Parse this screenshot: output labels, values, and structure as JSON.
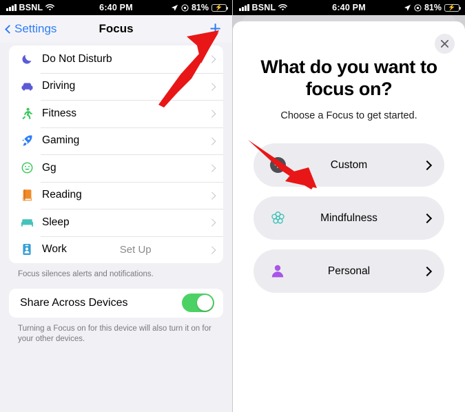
{
  "status_bar": {
    "carrier": "BSNL",
    "time": "6:40 PM",
    "battery_percent": "81%",
    "signal_icon": "cellular-bars-icon",
    "wifi_icon": "wifi-icon",
    "location_icon": "location-arrow-icon",
    "lock_icon": "screen-lock-rotation-icon",
    "battery_icon": "battery-charging-icon"
  },
  "colors": {
    "accent_blue": "#2e7df6",
    "toggle_green": "#4cd264",
    "annotation_red": "#e81616",
    "panel_background": "#f0f0f5",
    "card_background": "#ffffff",
    "option_background": "#ececf0"
  },
  "left_screen": {
    "nav": {
      "back_label": "Settings",
      "title": "Focus",
      "add_label": "+",
      "back_icon": "chevron-left-icon",
      "add_icon": "plus-icon"
    },
    "focus_items": [
      {
        "label": "Do Not Disturb",
        "icon": "moon-icon",
        "color": "#5b5bd6",
        "aux": ""
      },
      {
        "label": "Driving",
        "icon": "car-icon",
        "color": "#5b5bd6",
        "aux": ""
      },
      {
        "label": "Fitness",
        "icon": "running-person-icon",
        "color": "#34c759",
        "aux": ""
      },
      {
        "label": "Gaming",
        "icon": "rocket-icon",
        "color": "#2e7df6",
        "aux": ""
      },
      {
        "label": "Gg",
        "icon": "smiley-face-icon",
        "color": "#34c759",
        "aux": ""
      },
      {
        "label": "Reading",
        "icon": "book-icon",
        "color": "#f08a28",
        "aux": ""
      },
      {
        "label": "Sleep",
        "icon": "bed-icon",
        "color": "#44c2bd",
        "aux": ""
      },
      {
        "label": "Work",
        "icon": "id-badge-icon",
        "color": "#3a9fd6",
        "aux": "Set Up"
      }
    ],
    "list_footnote": "Focus silences alerts and notifications.",
    "share": {
      "label": "Share Across Devices",
      "toggle_state": "on",
      "footnote": "Turning a Focus on for this device will also turn it on for your other devices."
    }
  },
  "right_screen": {
    "close_icon": "close-icon",
    "title": "What do you want to focus on?",
    "subtitle": "Choose a Focus to get started.",
    "options": [
      {
        "label": "Custom",
        "icon": "plus-circle-icon",
        "color": "#4d4d52"
      },
      {
        "label": "Mindfulness",
        "icon": "flower-icon",
        "color": "#3cc0b4"
      },
      {
        "label": "Personal",
        "icon": "person-icon",
        "color": "#a855e8"
      }
    ]
  },
  "annotations": [
    {
      "name": "arrow-to-add-button",
      "direction": "up-right"
    },
    {
      "name": "arrow-to-custom-option",
      "direction": "down-right"
    }
  ]
}
